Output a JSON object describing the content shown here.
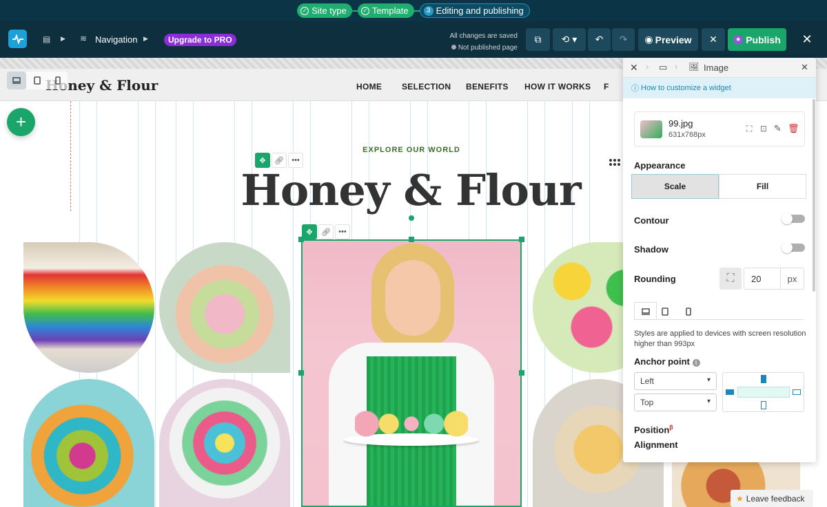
{
  "steps": [
    {
      "label": "Site type",
      "state": "done"
    },
    {
      "label": "Template",
      "state": "done"
    },
    {
      "number": "3",
      "label": "Editing and publishing",
      "state": "current"
    }
  ],
  "toolbar": {
    "nav_label": "Navigation",
    "upgrade_label": "Upgrade to PRO",
    "saved_status": "All changes are saved",
    "publish_status": "Not published page",
    "preview_label": "Preview",
    "publish_label": "Publish"
  },
  "site": {
    "brand": "Honey & Flour",
    "nav": [
      "HOME",
      "SELECTION",
      "BENEFITS",
      "HOW IT WORKS",
      "F"
    ],
    "tagline": "EXPLORE OUR WORLD",
    "hero_title": "Honey & Flour"
  },
  "panel": {
    "breadcrumb_label": "Image",
    "help_link": "How to customize a widget",
    "file_name": "99.jpg",
    "file_dims": "631x768px",
    "appearance_label": "Appearance",
    "appearance_options": [
      "Scale",
      "Fill"
    ],
    "contour_label": "Contour",
    "shadow_label": "Shadow",
    "rounding_label": "Rounding",
    "rounding_value": "20",
    "rounding_unit": "px",
    "device_note": "Styles are applied to devices with screen resolution higher than 993px",
    "anchor_label": "Anchor point",
    "anchor_h": "Left",
    "anchor_v": "Top",
    "position_label": "Position",
    "position_badge": "β",
    "alignment_label": "Alignment"
  },
  "feedback_label": "Leave feedback",
  "colors": {
    "accent": "#1aa56b",
    "topbar": "#0b3546",
    "toolbar": "#0e2f3d",
    "upgrade": "#8b2dd9"
  }
}
